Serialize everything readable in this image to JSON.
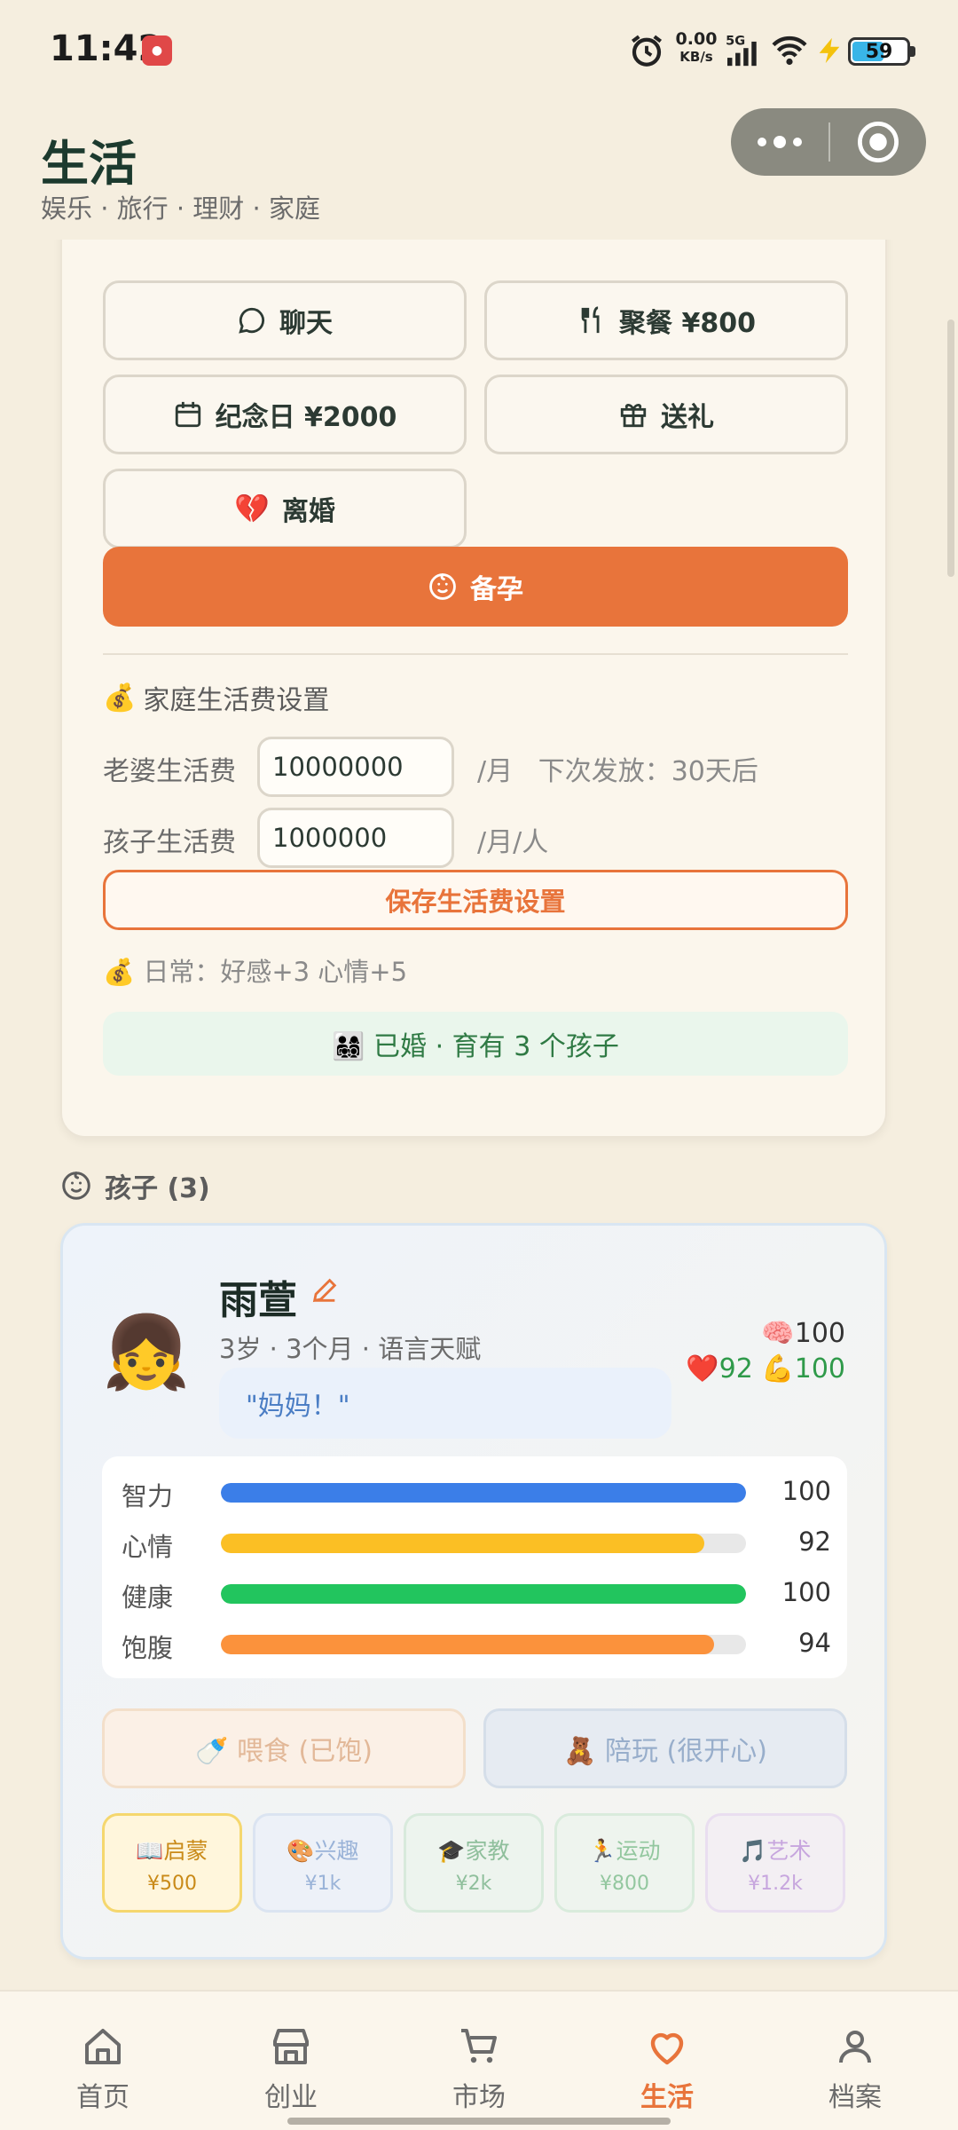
{
  "status": {
    "time": "11:42",
    "net_speed": "0.00",
    "net_unit": "KB/s",
    "signal": "5G",
    "battery": "59",
    "battery_level": 0.59
  },
  "header": {
    "title": "生活",
    "subtitle": "娱乐 · 旅行 · 理财 · 家庭"
  },
  "actions": {
    "chat": "聊天",
    "dinner": "聚餐 ¥800",
    "anniversary": "纪念日 ¥2000",
    "gift": "送礼",
    "divorce": "离婚",
    "pregnant": "备孕"
  },
  "allowance": {
    "title": "家庭生活费设置",
    "wife_label": "老婆生活费",
    "wife_value": "10000000",
    "wife_unit": "/月",
    "next_pay": "下次发放：30天后",
    "child_label": "孩子生活费",
    "child_value": "1000000",
    "child_unit": "/月/人",
    "save_label": "保存生活费设置",
    "daily": "日常：好感+3 心情+5"
  },
  "family_status": "👨‍👩‍👧‍👦 已婚 · 育有 3 个孩子",
  "kids_header": "孩子 (3)",
  "child": {
    "avatar": "👧",
    "name": "雨萱",
    "meta": "3岁 · 3个月 · 语言天赋",
    "quote": "\"妈妈！\"",
    "stat_top": "🧠100",
    "stat_heart": "❤️92",
    "stat_muscle": "💪100",
    "bars": [
      {
        "label": "智力",
        "value": 100,
        "display": "100",
        "color": "#3b7ee8"
      },
      {
        "label": "心情",
        "value": 92,
        "display": "92",
        "color": "#fbbf24"
      },
      {
        "label": "健康",
        "value": 100,
        "display": "100",
        "color": "#22c55e"
      },
      {
        "label": "饱腹",
        "value": 94,
        "display": "94",
        "color": "#fb923c"
      }
    ],
    "feed_label": "🍼 喂食 (已饱)",
    "play_label": "🧸 陪玩 (很开心)",
    "education": [
      {
        "label": "📖启蒙",
        "price": "¥500",
        "color": "#c98a18",
        "bg": "#fff6dc",
        "border": "#f5d76e"
      },
      {
        "label": "🎨兴趣",
        "price": "¥1k",
        "color": "#9ab3d8",
        "bg": "#edf1f8",
        "border": "#dbe4f1"
      },
      {
        "label": "🎓家教",
        "price": "¥2k",
        "color": "#8fbf9c",
        "bg": "#edf4ee",
        "border": "#d8eadc"
      },
      {
        "label": "🏃运动",
        "price": "¥800",
        "color": "#93c79f",
        "bg": "#eef4ee",
        "border": "#d9ebdc"
      },
      {
        "label": "🎵艺术",
        "price": "¥1.2k",
        "color": "#c7a6de",
        "bg": "#f3eff3",
        "border": "#e9def0"
      }
    ]
  },
  "nav": {
    "items": [
      {
        "label": "首页"
      },
      {
        "label": "创业"
      },
      {
        "label": "市场"
      },
      {
        "label": "生活"
      },
      {
        "label": "档案"
      }
    ],
    "active": "生活",
    "accent": "#e8743b"
  }
}
